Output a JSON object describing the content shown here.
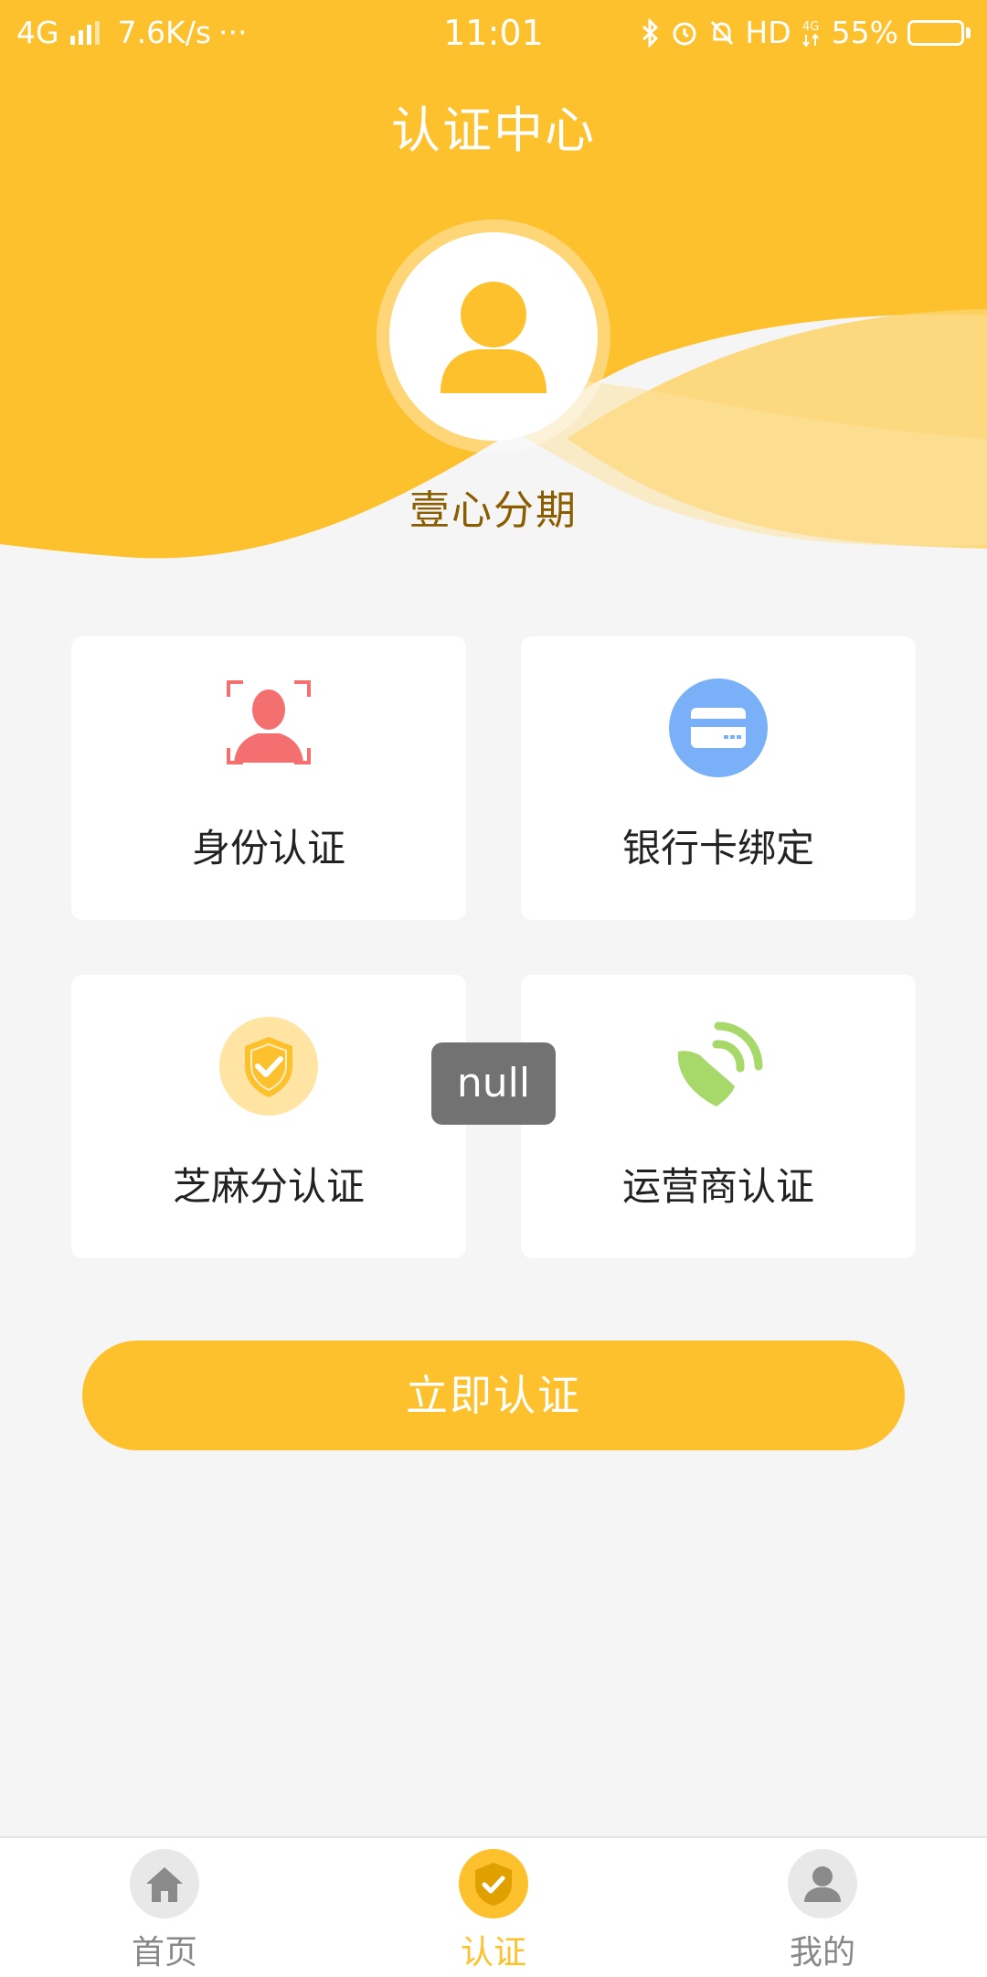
{
  "status_bar": {
    "network": "4G",
    "speed": "7.6K/s",
    "more": "···",
    "time": "11:01",
    "hd": "HD",
    "battery_percent": "55%",
    "battery_level": 0.55
  },
  "header": {
    "title": "认证中心",
    "app_name": "壹心分期"
  },
  "cards": [
    {
      "label": "身份认证",
      "icon": "face-id-icon"
    },
    {
      "label": "银行卡绑定",
      "icon": "bank-card-icon"
    },
    {
      "label": "芝麻分认证",
      "icon": "shield-check-icon"
    },
    {
      "label": "运营商认证",
      "icon": "signal-icon"
    }
  ],
  "toast": {
    "text": "null"
  },
  "cta": {
    "label": "立即认证"
  },
  "tabbar": {
    "tabs": [
      {
        "label": "首页",
        "icon": "home-icon",
        "active": false
      },
      {
        "label": "认证",
        "icon": "shield-check-icon",
        "active": true
      },
      {
        "label": "我的",
        "icon": "user-icon",
        "active": false
      }
    ]
  },
  "colors": {
    "brand_yellow": "#fec12e",
    "app_name_brown": "#8a5d00",
    "face_icon_red": "#f47070",
    "bank_icon_blue": "#7ab0f8",
    "signal_icon_green": "#a6d96a"
  }
}
